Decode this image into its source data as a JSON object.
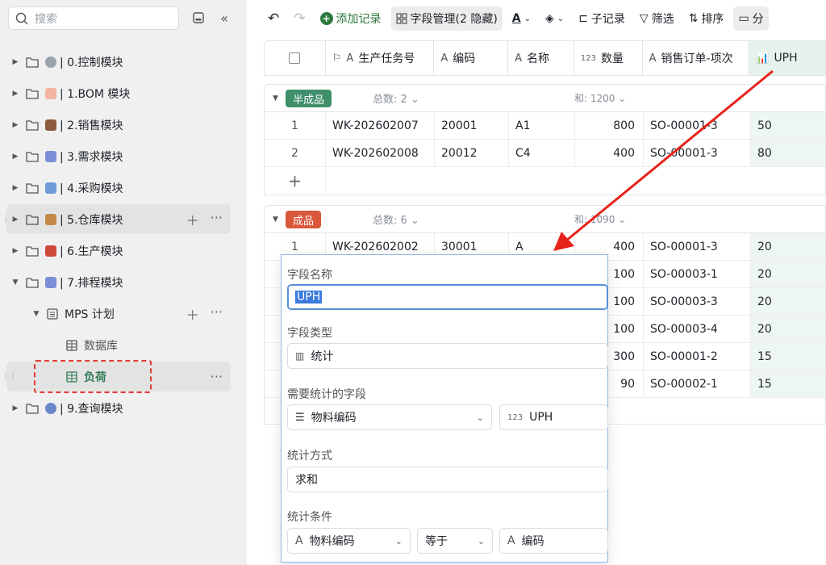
{
  "sidebar": {
    "search_placeholder": "搜索",
    "items": [
      {
        "label": "| 0.控制模块",
        "emoji_color": "#9aa3ad"
      },
      {
        "label": "| 1.BOM 模块",
        "emoji_color": "#f2b5a0"
      },
      {
        "label": "| 2.销售模块",
        "emoji_color": "#8b5a3c"
      },
      {
        "label": "| 3.需求模块",
        "emoji_color": "#7a8fd6"
      },
      {
        "label": "| 4.采购模块",
        "emoji_color": "#6f9bd8"
      },
      {
        "label": "| 5.仓库模块",
        "emoji_color": "#c48a4a"
      },
      {
        "label": "| 6.生产模块",
        "emoji_color": "#d04a3a"
      },
      {
        "label": "| 7.排程模块",
        "emoji_color": "#7a8fd6"
      },
      {
        "label": "MPS 计划"
      },
      {
        "label": "数据库"
      },
      {
        "label": "负荷"
      },
      {
        "label": "| 9.查询模块",
        "emoji_color": "#6a88c9"
      }
    ]
  },
  "toolbar": {
    "add_record": "添加记录",
    "field_manage": "字段管理(2 隐藏)",
    "sub_record": "子记录",
    "filter": "筛选",
    "sort": "排序",
    "group": "分"
  },
  "grid": {
    "columns": [
      "生产任务号",
      "编码",
      "名称",
      "数量",
      "销售订单-项次",
      "UPH"
    ],
    "col_type_123": "123",
    "groups": [
      {
        "tag": "半成品",
        "tag_color": "#3f8f6b",
        "total": "总数: 2",
        "sum": "和: 1200",
        "rows": [
          {
            "n": "1",
            "task": "WK-202602007",
            "code": "20001",
            "name": "A1",
            "qty": "800",
            "so": "SO-00001-3",
            "uph": "50"
          },
          {
            "n": "2",
            "task": "WK-202602008",
            "code": "20012",
            "name": "C4",
            "qty": "400",
            "so": "SO-00001-3",
            "uph": "80"
          }
        ],
        "add": "+"
      },
      {
        "tag": "成品",
        "tag_color": "#d9573b",
        "total": "总数: 6",
        "sum": "和: 1090",
        "rows": [
          {
            "n": "1",
            "task": "WK-202602002",
            "code": "30001",
            "name": "A",
            "qty": "400",
            "so": "SO-00001-3",
            "uph": "20"
          },
          {
            "n": "",
            "task": "",
            "code": "",
            "name": "",
            "qty": "100",
            "so": "SO-00003-1",
            "uph": "20"
          },
          {
            "n": "",
            "task": "",
            "code": "",
            "name": "",
            "qty": "100",
            "so": "SO-00003-3",
            "uph": "20"
          },
          {
            "n": "",
            "task": "",
            "code": "",
            "name": "",
            "qty": "100",
            "so": "SO-00003-4",
            "uph": "20"
          },
          {
            "n": "",
            "task": "",
            "code": "",
            "name": "",
            "qty": "300",
            "so": "SO-00001-2",
            "uph": "15"
          },
          {
            "n": "",
            "task": "",
            "code": "",
            "name": "",
            "qty": "90",
            "so": "SO-00002-1",
            "uph": "15"
          }
        ]
      }
    ]
  },
  "popup": {
    "field_name_label": "字段名称",
    "field_name_value": "UPH",
    "field_type_label": "字段类型",
    "field_type_value": "统计",
    "stat_field_label": "需要统计的字段",
    "stat_field_value": "物料编码",
    "stat_target_prefix": "123",
    "stat_target_value": "UPH",
    "method_label": "统计方式",
    "method_value": "求和",
    "cond_label": "统计条件",
    "cond_field": "物料编码",
    "cond_op": "等于",
    "cond_value": "编码"
  },
  "colors": {
    "arrow": "#e8231c",
    "uph_bg": "#e8f2ec",
    "accent": "#2b7a3d"
  }
}
